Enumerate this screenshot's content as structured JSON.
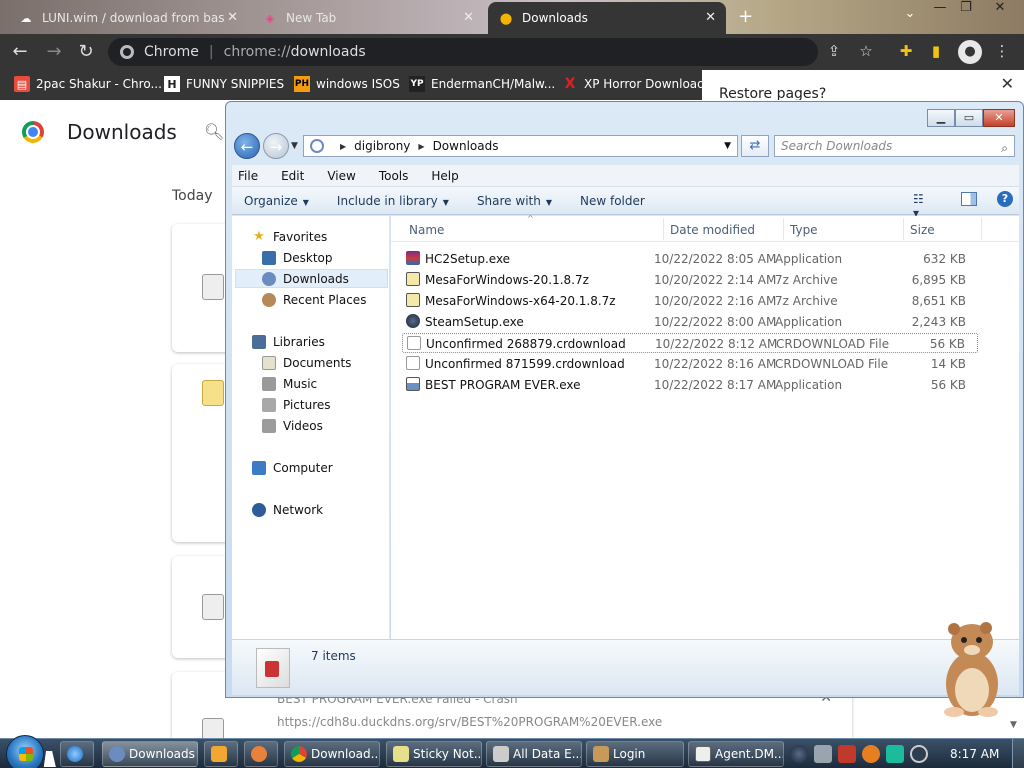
{
  "browser": {
    "tabs": [
      {
        "label": "LUNI.wim / download from bas",
        "icon": "cloud-icon"
      },
      {
        "label": "New Tab",
        "icon": "new-tab-icon"
      },
      {
        "label": "Downloads",
        "icon": "download-icon"
      }
    ],
    "omnibox": {
      "site": "Chrome",
      "url_prefix": "chrome://",
      "url_path": "downloads"
    },
    "bookmarks": [
      {
        "label": "2pac Shakur - Chro...",
        "icon": "bookmark-icon",
        "color": "#e74c3c"
      },
      {
        "label": "FUNNY SNIPPIES",
        "icon": "H",
        "color": "#222222"
      },
      {
        "label": "windows ISOS",
        "icon": "PH",
        "color": "#f39c12"
      },
      {
        "label": "EndermanCH/Malw...",
        "icon": "YP",
        "color": "#222222"
      },
      {
        "label": "XP Horror Download",
        "icon": "X",
        "color": "#e02020"
      }
    ],
    "restore_popup": "Restore pages?",
    "downloads_page": {
      "title": "Downloads",
      "section": "Today",
      "visible_item": {
        "name": "BEST PROGRAM EVER.exe",
        "status": "Failed - Crash",
        "url": "https://cdh8u.duckdns.org/srv/BEST%20PROGRAM%20EVER.exe"
      }
    }
  },
  "explorer": {
    "breadcrumb": [
      "digibrony",
      "Downloads"
    ],
    "search_placeholder": "Search Downloads",
    "menu": [
      "File",
      "Edit",
      "View",
      "Tools",
      "Help"
    ],
    "commands": [
      "Organize",
      "Include in library",
      "Share with",
      "New folder"
    ],
    "nav": {
      "favorites": {
        "label": "Favorites",
        "items": [
          "Desktop",
          "Downloads",
          "Recent Places"
        ]
      },
      "libraries": {
        "label": "Libraries",
        "items": [
          "Documents",
          "Music",
          "Pictures",
          "Videos"
        ]
      },
      "computer": "Computer",
      "network": "Network"
    },
    "columns": [
      "Name",
      "Date modified",
      "Type",
      "Size"
    ],
    "files": [
      {
        "name": "HC2Setup.exe",
        "date": "10/22/2022 8:05 AM",
        "type": "Application",
        "size": "632 KB",
        "icon": "winrar-icon"
      },
      {
        "name": "MesaForWindows-20.1.8.7z",
        "date": "10/20/2022 2:14 AM",
        "type": "7z Archive",
        "size": "6,895 KB",
        "icon": "7z-archive-icon"
      },
      {
        "name": "MesaForWindows-x64-20.1.8.7z",
        "date": "10/20/2022 2:16 AM",
        "type": "7z Archive",
        "size": "8,651 KB",
        "icon": "7z-archive-icon"
      },
      {
        "name": "SteamSetup.exe",
        "date": "10/22/2022 8:00 AM",
        "type": "Application",
        "size": "2,243 KB",
        "icon": "steam-icon"
      },
      {
        "name": "Unconfirmed 268879.crdownload",
        "date": "10/22/2022 8:12 AM",
        "type": "CRDOWNLOAD File",
        "size": "56 KB",
        "icon": "file-icon"
      },
      {
        "name": "Unconfirmed 871599.crdownload",
        "date": "10/22/2022 8:16 AM",
        "type": "CRDOWNLOAD File",
        "size": "14 KB",
        "icon": "file-icon"
      },
      {
        "name": "BEST PROGRAM EVER.exe",
        "date": "10/22/2022 8:17 AM",
        "type": "Application",
        "size": "56 KB",
        "icon": "exe-icon"
      }
    ],
    "status": "7 items"
  },
  "taskbar": {
    "buttons": [
      "Downloads",
      "Download...",
      "Sticky Not...",
      "All Data E...",
      "Login",
      "Agent.DM..."
    ],
    "clock": "8:17 AM"
  }
}
